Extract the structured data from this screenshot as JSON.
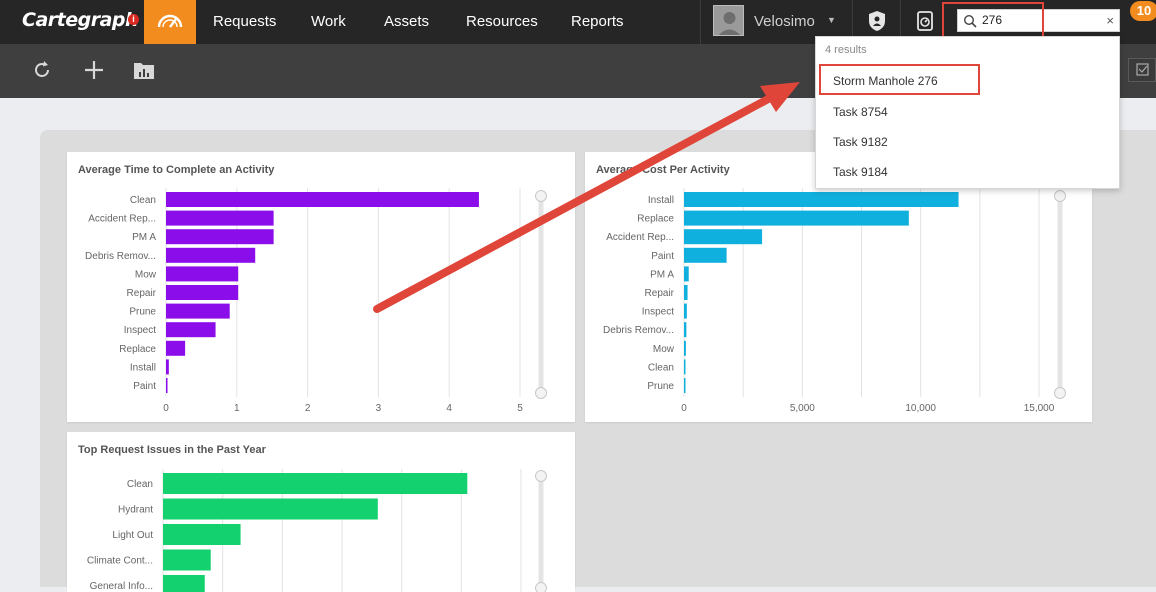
{
  "app": {
    "logo": "Cartegraph",
    "info_badge": "i"
  },
  "nav": {
    "items": [
      "Requests",
      "Work",
      "Assets",
      "Resources",
      "Reports"
    ]
  },
  "user": {
    "name": "Velosimo"
  },
  "search": {
    "value": "276",
    "clear": "×"
  },
  "notifications": {
    "count": "10"
  },
  "results": {
    "count_label": "4 results",
    "items": [
      "Storm Manhole 276",
      "Task 8754",
      "Task 9182",
      "Task 9184"
    ]
  },
  "colors": {
    "orange": "#f28c1e",
    "purple": "#8b0eea",
    "blue": "#10b0de",
    "green": "#12d16e",
    "annotation_red": "#e0453a"
  },
  "icons": {
    "home": "speedometer-icon",
    "refresh": "refresh-icon",
    "add": "plus-icon",
    "report": "chart-folder-icon",
    "shield": "shield-icon",
    "timer": "stopwatch-icon",
    "search": "search-icon"
  },
  "chart_data": [
    {
      "type": "bar",
      "title": "Average Time to Complete an Activity",
      "orientation": "horizontal",
      "categories": [
        "Clean",
        "Accident Rep...",
        "PM A",
        "Debris Remov...",
        "Mow",
        "Repair",
        "Prune",
        "Inspect",
        "Replace",
        "Install",
        "Paint"
      ],
      "values": [
        4.42,
        1.52,
        1.52,
        1.26,
        1.02,
        1.02,
        0.9,
        0.7,
        0.27,
        0.04,
        0.01
      ],
      "xticks": [
        "0",
        "1",
        "2",
        "3",
        "4",
        "5"
      ],
      "xlim": [
        0,
        5
      ],
      "color": "#8b0eea",
      "grid": true
    },
    {
      "type": "bar",
      "title": "Average Cost Per Activity",
      "orientation": "horizontal",
      "categories": [
        "Install",
        "Replace",
        "Accident Rep...",
        "Paint",
        "PM A",
        "Repair",
        "Inspect",
        "Debris Remov...",
        "Mow",
        "Clean",
        "Prune"
      ],
      "values": [
        11600,
        9500,
        3300,
        1800,
        200,
        150,
        120,
        100,
        80,
        60,
        40
      ],
      "xticks": [
        "0",
        "5,000",
        "10,000",
        "15,000"
      ],
      "xlim": [
        0,
        15000
      ],
      "color": "#10b0de",
      "grid": true
    },
    {
      "type": "bar",
      "title": "Top Request Issues in the Past Year",
      "orientation": "horizontal",
      "categories": [
        "Clean",
        "Hydrant",
        "Light Out",
        "Climate Cont...",
        "General Info..."
      ],
      "values": [
        51,
        36,
        13,
        8,
        7
      ],
      "xlim": [
        0,
        60
      ],
      "color": "#12d16e",
      "grid": true
    }
  ]
}
